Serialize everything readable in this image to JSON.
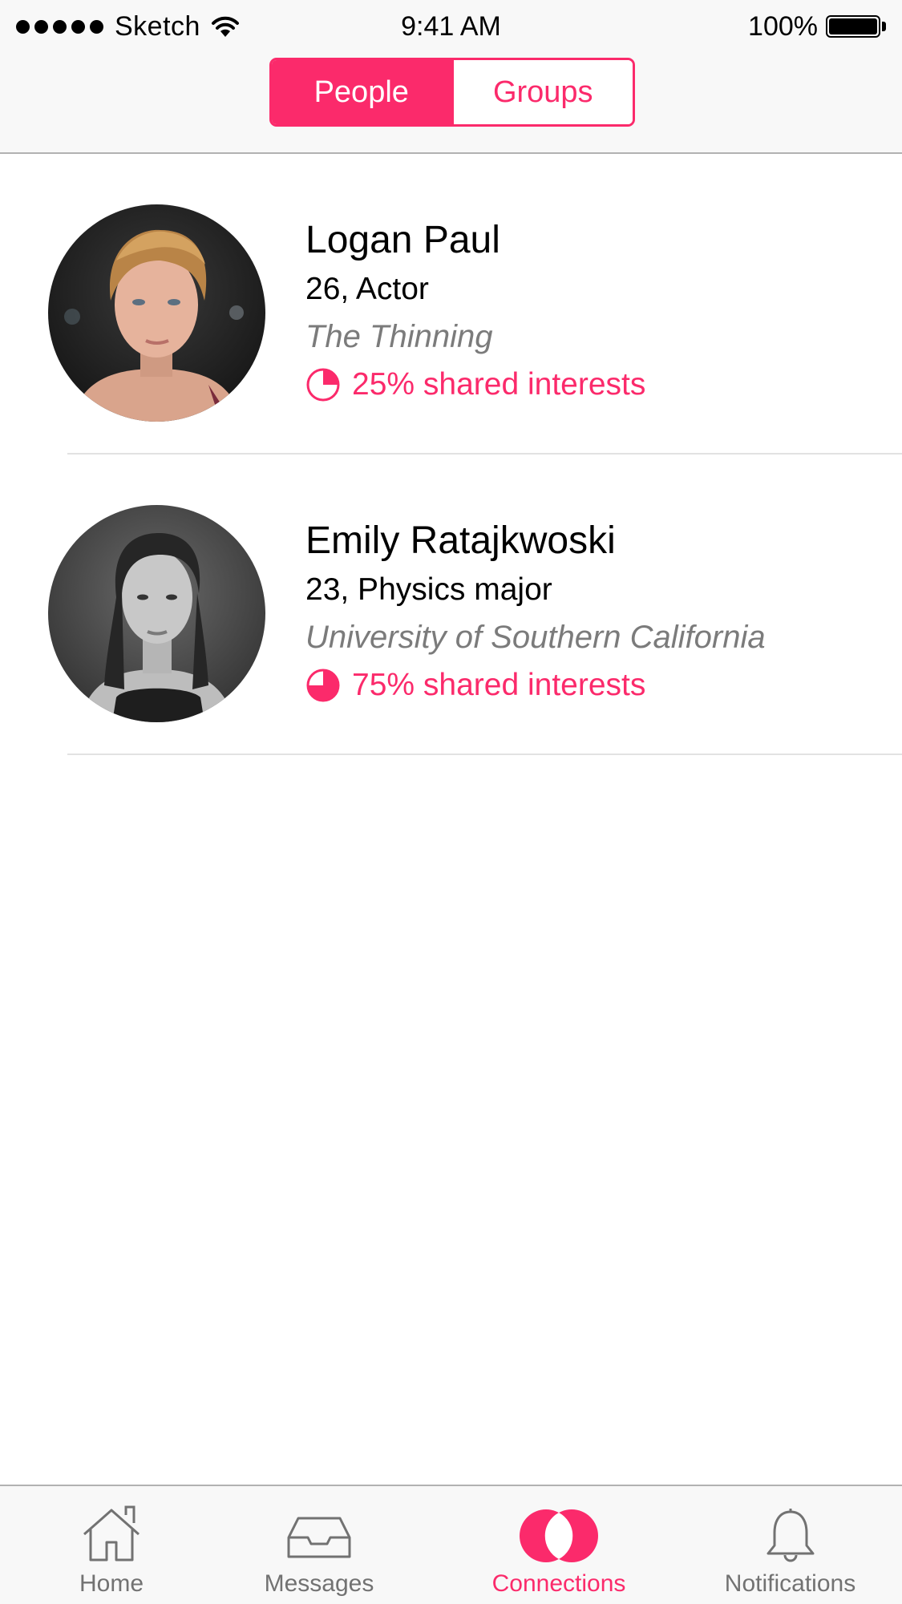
{
  "status_bar": {
    "carrier": "Sketch",
    "time": "9:41 AM",
    "battery": "100%"
  },
  "segmented_control": {
    "people_label": "People",
    "groups_label": "Groups",
    "selected": "People"
  },
  "colors": {
    "accent": "#fb2a6b",
    "secondary_text": "#7b7b7b",
    "tab_inactive": "#727272"
  },
  "connections": [
    {
      "name": "Logan Paul",
      "details": "26, Actor",
      "affiliation": "The Thinning",
      "shared_interests_label": "25% shared interests",
      "shared_fraction": 0.25
    },
    {
      "name": "Emily Ratajkwoski",
      "details": "23, Physics major",
      "affiliation": "University of Southern California",
      "shared_interests_label": "75% shared interests",
      "shared_fraction": 0.75
    }
  ],
  "tab_bar": {
    "items": [
      {
        "label": "Home",
        "icon": "home-icon"
      },
      {
        "label": "Messages",
        "icon": "inbox-icon"
      },
      {
        "label": "Connections",
        "icon": "connections-icon",
        "active": true
      },
      {
        "label": "Notifications",
        "icon": "bell-icon"
      }
    ]
  }
}
